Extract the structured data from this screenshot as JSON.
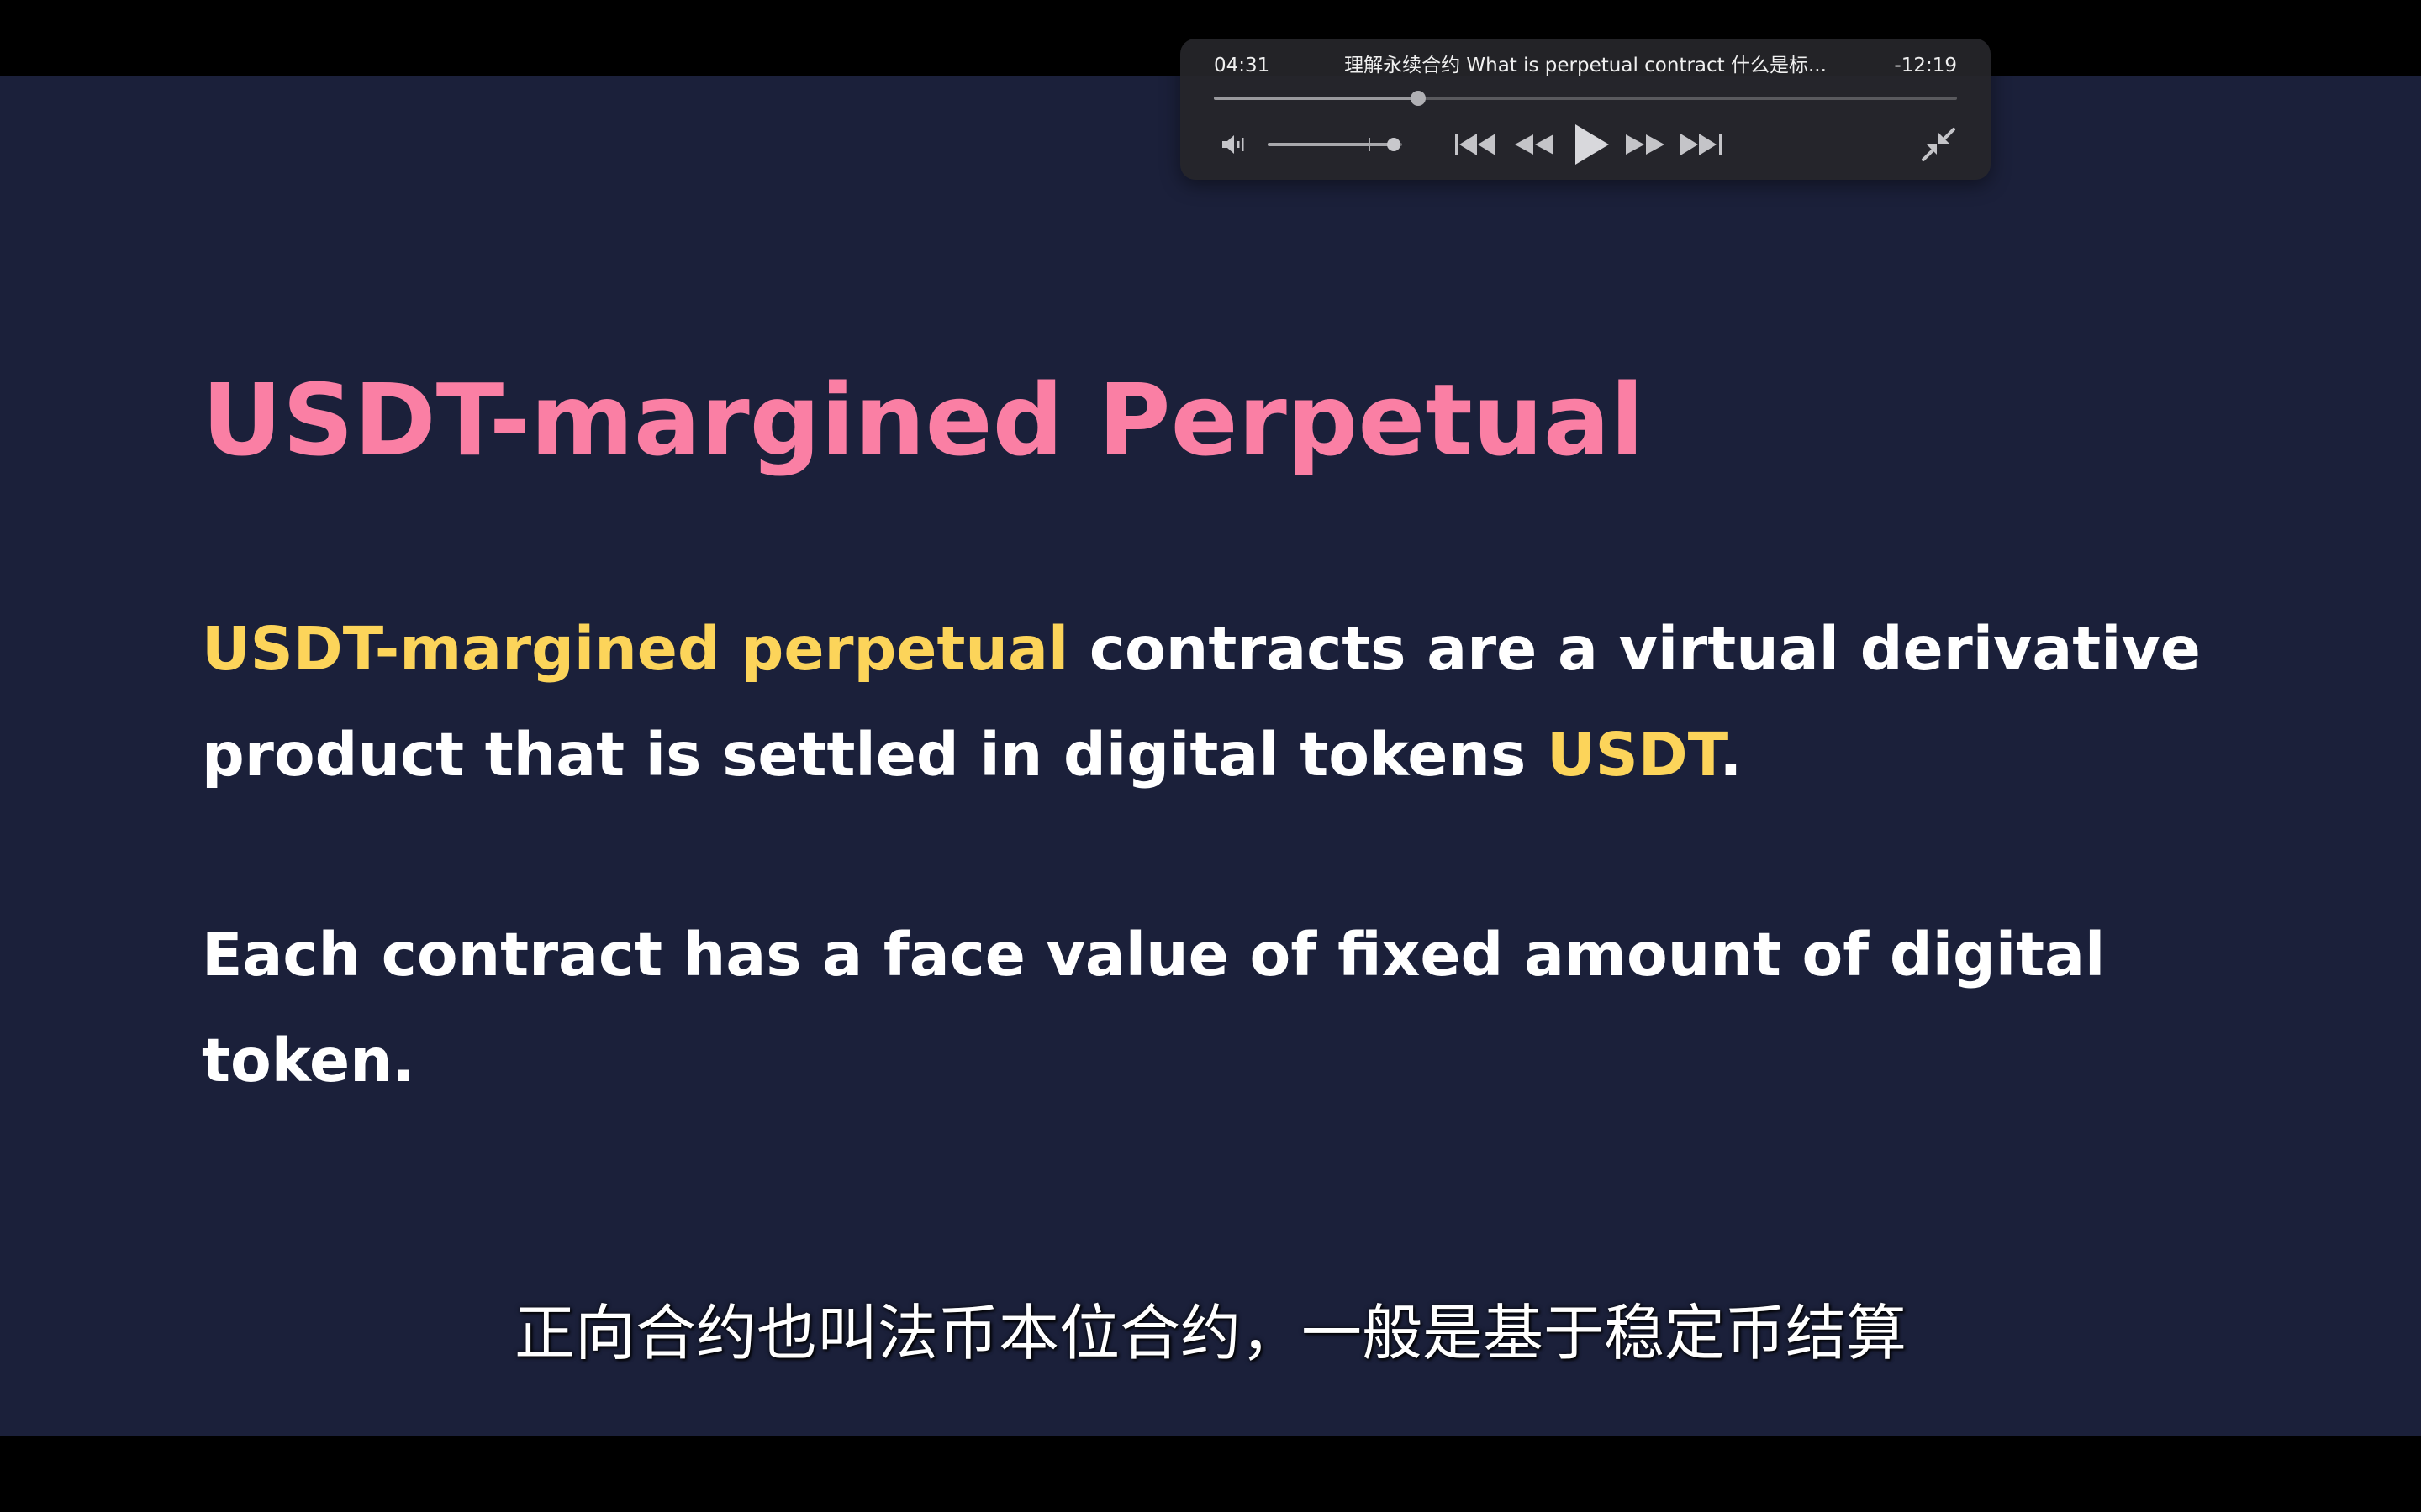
{
  "slide": {
    "title": "USDT-margined Perpetual",
    "paragraph1": {
      "highlight": "USDT-margined perpetual",
      "text_a": " contracts are a virtual derivative product that is settled in digital tokens ",
      "highlight2": "USDT",
      "text_b": "."
    },
    "paragraph2": "Each contract has a face value of fixed amount of digital token."
  },
  "subtitle": "正向合约也叫法币本位合约，一般是基于稳定币结算",
  "player": {
    "elapsed": "04:31",
    "remaining": "-12:19",
    "title": "理解永续合约 What is perpetual contract 什么是标...",
    "progress_fraction": 0.275,
    "volume_fraction": 0.94,
    "icons": {
      "volume": "speaker-icon",
      "skip_back": "skip-back-icon",
      "rewind": "rewind-icon",
      "play": "play-icon",
      "fast_forward": "fast-forward-icon",
      "skip_forward": "skip-forward-icon",
      "exit_fullscreen": "exit-fullscreen-icon"
    }
  },
  "colors": {
    "background": "#1b203a",
    "title": "#fa7fa4",
    "highlight": "#fcd45a",
    "body_text": "#ffffff"
  }
}
